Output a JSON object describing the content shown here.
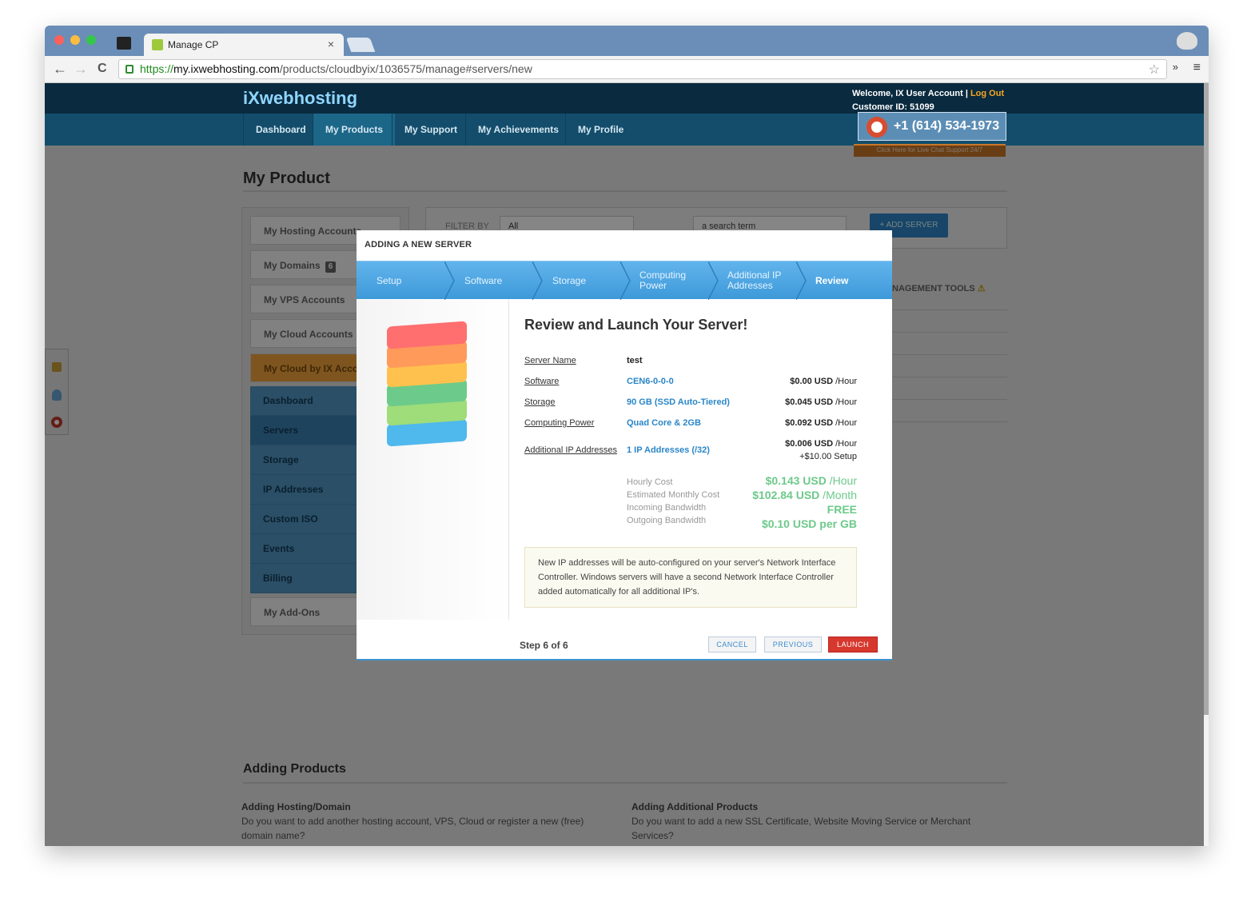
{
  "browser": {
    "tab_title": "Manage CP",
    "tab_close": "×",
    "url_scheme": "https://",
    "url_domain": "my.ixwebhosting.com",
    "url_path": "/products/cloudbyix/1036575/manage#servers/new",
    "back": "←",
    "forward": "→",
    "reload": "C",
    "star": "☆",
    "menu": "≡",
    "ext": "»"
  },
  "header": {
    "logo_ix": "iX",
    "logo_name": "webhosting",
    "welcome": "Welcome, IX User Account | ",
    "logout": "Log Out",
    "customer_id": "Customer ID: 51099",
    "phone": "+1 (614) 534-1973",
    "chat": "Click Here for Live Chat Support 24/7"
  },
  "nav": [
    "Dashboard",
    "My Products",
    "My Support",
    "My Achievements",
    "My Profile"
  ],
  "page": {
    "title": "My Product",
    "sidebar": [
      {
        "label": "My Hosting Accounts"
      },
      {
        "label": "My Domains",
        "badge": "6"
      },
      {
        "label": "My VPS Accounts"
      },
      {
        "label": "My Cloud Accounts"
      },
      {
        "label": "My Cloud by IX Accounts"
      }
    ],
    "subitems": [
      "Dashboard",
      "Servers",
      "Storage",
      "IP Addresses",
      "Custom ISO",
      "Events",
      "Billing"
    ],
    "addons": "My Add-Ons",
    "filter_label": "FILTER BY",
    "filter_value": "All",
    "search_placeholder": "a search term",
    "add_server": "+ ADD SERVER",
    "mgmt_tools": "NAGEMENT TOOLS",
    "adding_title": "Adding Products",
    "col1_title": "Adding Hosting/Domain",
    "col1_text": "Do you want to add another hosting account, VPS, Cloud or register a new (free) domain name?",
    "col2_title": "Adding Additional Products",
    "col2_text": "Do you want to add a new SSL Certificate, Website Moving Service or Merchant Services?"
  },
  "modal": {
    "title": "ADDING A NEW SERVER",
    "steps": [
      {
        "l1": "Setup",
        "l2": ""
      },
      {
        "l1": "Software",
        "l2": ""
      },
      {
        "l1": "Storage",
        "l2": ""
      },
      {
        "l1": "Computing",
        "l2": "Power"
      },
      {
        "l1": "Additional IP",
        "l2": "Addresses"
      },
      {
        "l1": "Review",
        "l2": ""
      }
    ],
    "heading": "Review and Launch Your Server!",
    "rows": [
      {
        "label": "Server Name",
        "value": "test",
        "price": "",
        "unit": ""
      },
      {
        "label": "Software",
        "value": "CEN6-0-0-0",
        "price": "$0.00 USD",
        "unit": "/Hour"
      },
      {
        "label": "Storage",
        "value": "90 GB (SSD Auto-Tiered)",
        "price": "$0.045 USD",
        "unit": "/Hour"
      },
      {
        "label": "Computing Power",
        "value": "Quad Core & 2GB",
        "price": "$0.092 USD",
        "unit": "/Hour"
      },
      {
        "label": "Additional IP Addresses",
        "value": "1 IP Addresses (/32)",
        "price": "$0.006 USD",
        "unit": "/Hour",
        "extra": "+$10.00 Setup"
      }
    ],
    "summary": [
      {
        "label": "Hourly Cost",
        "value": "$0.143 USD",
        "unit": " /Hour"
      },
      {
        "label": "Estimated Monthly Cost",
        "value": "$102.84 USD",
        "unit": " /Month"
      },
      {
        "label": "Incoming Bandwidth",
        "value": "FREE",
        "unit": ""
      },
      {
        "label": "Outgoing Bandwidth",
        "value": "$0.10 USD per GB",
        "unit": ""
      }
    ],
    "note": "New IP addresses will be auto-configured on your server's Network Interface Controller. Windows servers will have a second Network Interface Controller added automatically for all additional IP's.",
    "step_of": "Step 6 of 6",
    "cancel": "CANCEL",
    "previous": "PREVIOUS",
    "launch": "LAUNCH"
  },
  "colors": {
    "accent": "#3e99d9",
    "launch": "#d6382e",
    "price_green": "#6cc98a",
    "orange": "#f2a43c"
  }
}
